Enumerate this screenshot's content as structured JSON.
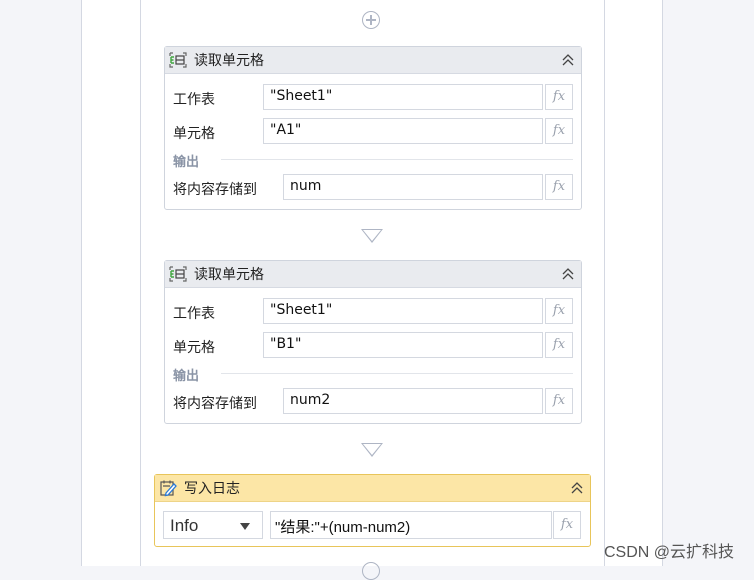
{
  "workflow": {
    "activities": [
      {
        "title": "读取单元格",
        "icon": "excel-read-cell-icon",
        "fields": [
          {
            "label": "工作表",
            "value": "\"Sheet1\""
          },
          {
            "label": "单元格",
            "value": "\"A1\""
          }
        ],
        "output_section": "输出",
        "output": {
          "label": "将内容存储到",
          "value": "num"
        }
      },
      {
        "title": "读取单元格",
        "icon": "excel-read-cell-icon",
        "fields": [
          {
            "label": "工作表",
            "value": "\"Sheet1\""
          },
          {
            "label": "单元格",
            "value": "\"B1\""
          }
        ],
        "output_section": "输出",
        "output": {
          "label": "将内容存储到",
          "value": "num2"
        }
      }
    ],
    "log": {
      "title": "写入日志",
      "icon": "write-log-icon",
      "level": "Info",
      "message": "\"结果:\"+(num-num2)"
    },
    "fx_label": "fx"
  },
  "colors": {
    "log_header": "#fce6a6",
    "log_border": "#e8c55a",
    "card_header": "#e9ebef"
  },
  "watermark": "CSDN @云扩科技"
}
